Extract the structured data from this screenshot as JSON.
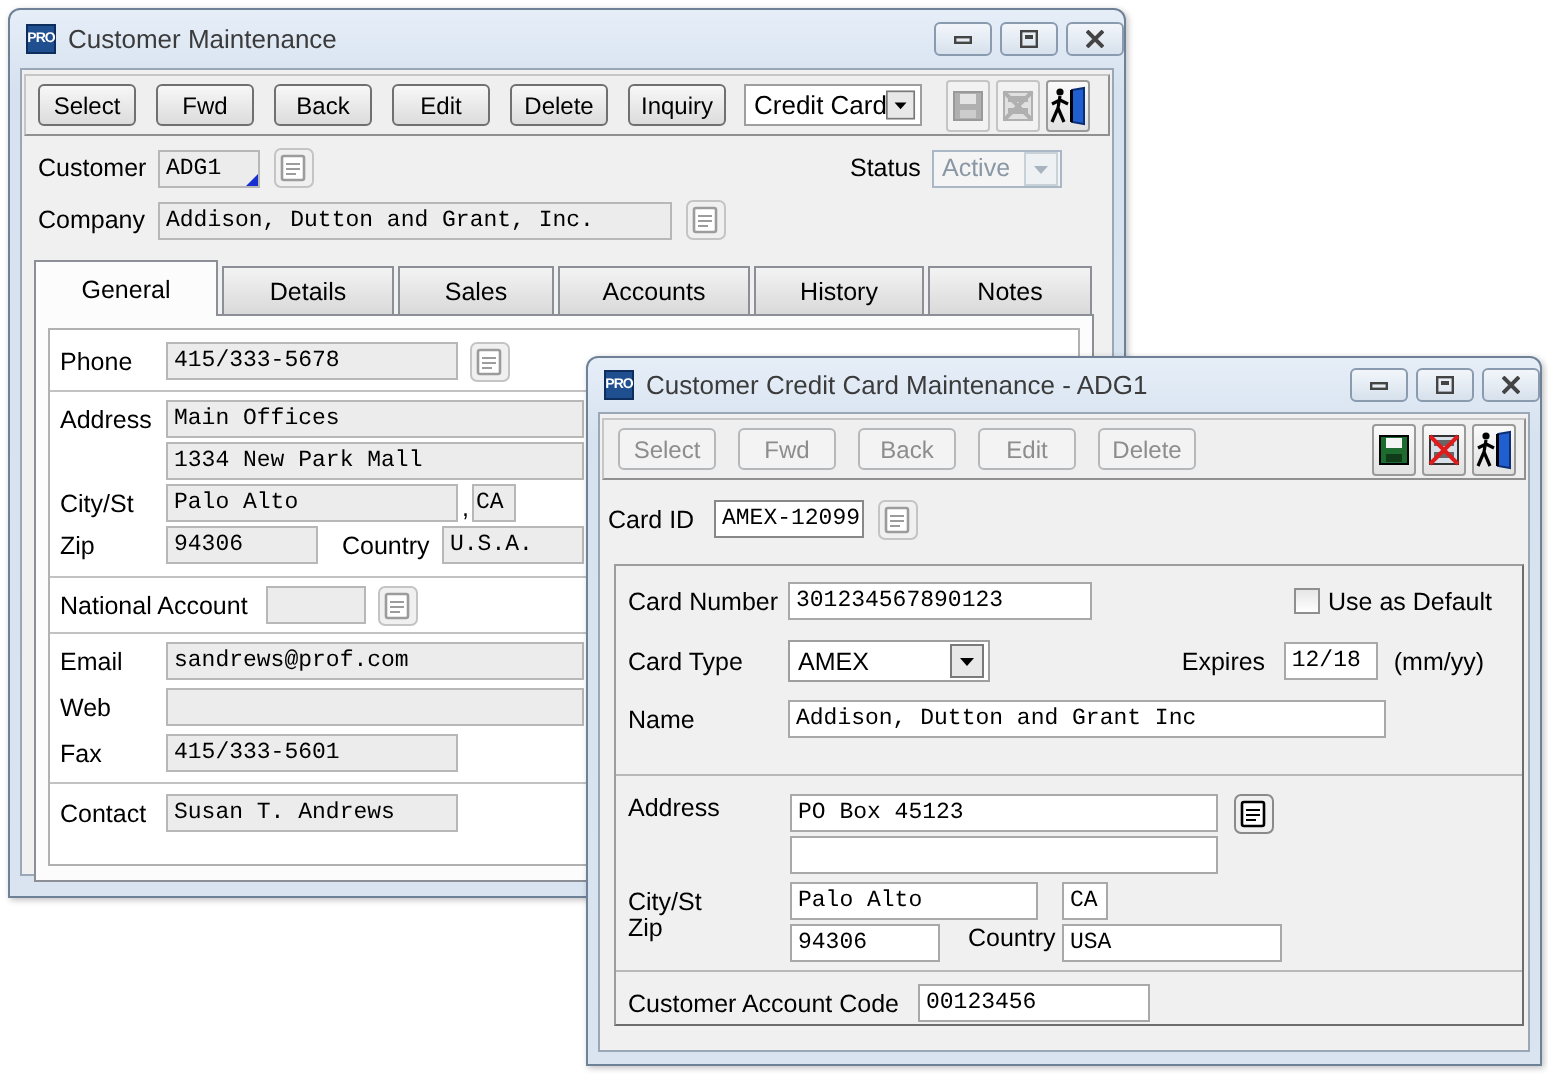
{
  "customer_window": {
    "logo": "PRO",
    "title": "Customer Maintenance",
    "toolbar": {
      "buttons": [
        {
          "label": "Select",
          "disabled": false
        },
        {
          "label": "Fwd",
          "disabled": false
        },
        {
          "label": "Back",
          "disabled": false
        },
        {
          "label": "Edit",
          "disabled": false
        },
        {
          "label": "Delete",
          "disabled": false
        },
        {
          "label": "Inquiry",
          "disabled": false
        }
      ],
      "view_select": {
        "value": "Credit Card"
      },
      "icons": [
        {
          "kind": "save",
          "disabled": true
        },
        {
          "kind": "delete",
          "disabled": true
        },
        {
          "kind": "exit",
          "disabled": false
        }
      ]
    },
    "customer": {
      "label": "Customer",
      "value": "ADG1"
    },
    "status": {
      "label": "Status",
      "value": "Active",
      "disabled": true
    },
    "company": {
      "label": "Company",
      "value": "Addison, Dutton and Grant, Inc."
    },
    "tabs": [
      {
        "label": "General",
        "selected": true
      },
      {
        "label": "Details",
        "selected": false
      },
      {
        "label": "Sales",
        "selected": false
      },
      {
        "label": "Accounts",
        "selected": false
      },
      {
        "label": "History",
        "selected": false
      },
      {
        "label": "Notes",
        "selected": false
      }
    ],
    "general": {
      "phone": {
        "label": "Phone",
        "value": "415/333-5678"
      },
      "address": {
        "label": "Address",
        "lines": [
          "Main Offices",
          "1334 New Park Mall"
        ]
      },
      "city_state": {
        "label": "City/St",
        "city": "Palo Alto",
        "separator": ",",
        "state": "CA"
      },
      "zip": {
        "label": "Zip",
        "value": "94306"
      },
      "country": {
        "label": "Country",
        "value": "U.S.A."
      },
      "national_account": {
        "label": "National Account"
      },
      "email": {
        "label": "Email",
        "value": "sandrews@prof.com"
      },
      "web": {
        "label": "Web"
      },
      "fax": {
        "label": "Fax",
        "value": "415/333-5601"
      },
      "contact": {
        "label": "Contact",
        "value": "Susan T. Andrews"
      }
    }
  },
  "credit_card_window": {
    "logo": "PRO",
    "title": "Customer Credit Card Maintenance - ADG1",
    "toolbar": {
      "buttons": [
        {
          "label": "Select",
          "disabled": true
        },
        {
          "label": "Fwd",
          "disabled": true
        },
        {
          "label": "Back",
          "disabled": true
        },
        {
          "label": "Edit",
          "disabled": true
        },
        {
          "label": "Delete",
          "disabled": true
        }
      ],
      "icons": [
        {
          "kind": "save",
          "disabled": false
        },
        {
          "kind": "delete",
          "disabled": false
        },
        {
          "kind": "exit",
          "disabled": false
        }
      ]
    },
    "card_id": {
      "label": "Card ID",
      "value": "AMEX-12099"
    },
    "card_number": {
      "label": "Card Number",
      "value": "301234567890123"
    },
    "use_as_default": {
      "label": "Use as Default",
      "checked": false
    },
    "card_type": {
      "label": "Card Type",
      "value": "AMEX"
    },
    "expires": {
      "label": "Expires",
      "value": "12/18",
      "hint": "(mm/yy)"
    },
    "name": {
      "label": "Name",
      "value": "Addison, Dutton and Grant Inc"
    },
    "address": {
      "label": "Address",
      "lines": [
        "PO Box 45123"
      ]
    },
    "city_state": {
      "label": "City/St",
      "city": "Palo Alto",
      "state": "CA"
    },
    "zip": {
      "label": "Zip",
      "value": "94306"
    },
    "country": {
      "label": "Country",
      "value": "USA"
    },
    "account_code": {
      "label": "Customer Account Code",
      "value": "00123456"
    }
  }
}
